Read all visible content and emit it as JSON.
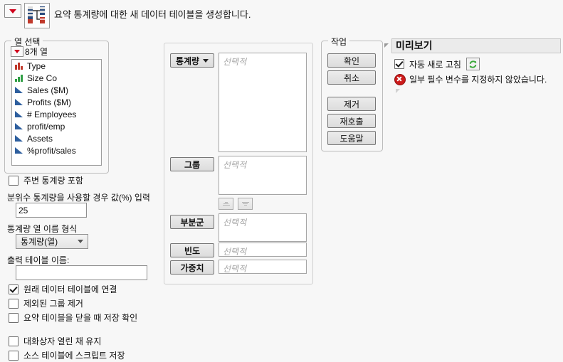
{
  "header": {
    "menu_icon": "red-triangle-menu-icon",
    "app_icon": "summary-table-icon",
    "title": "요약 통계량에 대한 새 데이터 테이블을 생성합니다."
  },
  "column_select": {
    "legend": "열 선택",
    "count_label": "8개 열",
    "columns": [
      {
        "name": "Type",
        "type": "nominal"
      },
      {
        "name": "Size Co",
        "type": "ordinal"
      },
      {
        "name": "Sales ($M)",
        "type": "continuous"
      },
      {
        "name": "Profits ($M)",
        "type": "continuous"
      },
      {
        "name": "# Employees",
        "type": "continuous"
      },
      {
        "name": "profit/emp",
        "type": "continuous"
      },
      {
        "name": "Assets",
        "type": "continuous"
      },
      {
        "name": "%profit/sales",
        "type": "continuous"
      }
    ]
  },
  "options": {
    "include_marginal_label": "주변 통계량 포함",
    "include_marginal_checked": false,
    "quantile_label": "분위수 통계량을 사용할 경우 값(%) 입력",
    "quantile_value": "25",
    "colname_format_label": "통계량 열 이름 형식",
    "colname_format_value": "통계량(열)",
    "output_table_label": "출력 테이블 이름:",
    "output_table_value": "",
    "output_table_placeholder": "",
    "link_label": "원래 데이터 테이블에 연결",
    "link_checked": true,
    "remove_excluded_label": "제외된 그룹 제거",
    "remove_excluded_checked": false,
    "confirm_save_label": "요약 테이블을 닫을 때 저장 확인",
    "confirm_save_checked": false,
    "keep_dialog_label": "대화상자 열린 채 유지",
    "keep_dialog_checked": false,
    "save_script_label": "소스 테이블에 스크립트 저장",
    "save_script_checked": false
  },
  "roles": {
    "statistic_label": "통계량",
    "statistic_placeholder": "선택적",
    "group_label": "그룹",
    "group_placeholder": "선택적",
    "subgroup_label": "부분군",
    "subgroup_placeholder": "선택적",
    "freq_label": "빈도",
    "freq_placeholder": "선택적",
    "weight_label": "가중치",
    "weight_placeholder": "선택적",
    "sort_asc_icon": "sort-ascending-icon",
    "sort_desc_icon": "sort-descending-icon"
  },
  "actions": {
    "legend": "작업",
    "ok": "확인",
    "cancel": "취소",
    "remove": "제거",
    "recall": "재호출",
    "help": "도움말"
  },
  "preview": {
    "title": "미리보기",
    "auto_refresh_label": "자동 새로 고침",
    "auto_refresh_checked": true,
    "refresh_icon": "refresh-icon",
    "error_icon": "error-circle-icon",
    "error_text": "일부 필수 변수를 지정하지 않았습니다."
  },
  "colors": {
    "background": "#f7f7f7",
    "nominal_icon": "#c0392b",
    "ordinal_icon": "#2f9e44",
    "continuous_icon": "#2e5f9e",
    "error_red": "#cc1b1b",
    "refresh_green": "#3aa93a",
    "menu_red": "#d0021b"
  }
}
